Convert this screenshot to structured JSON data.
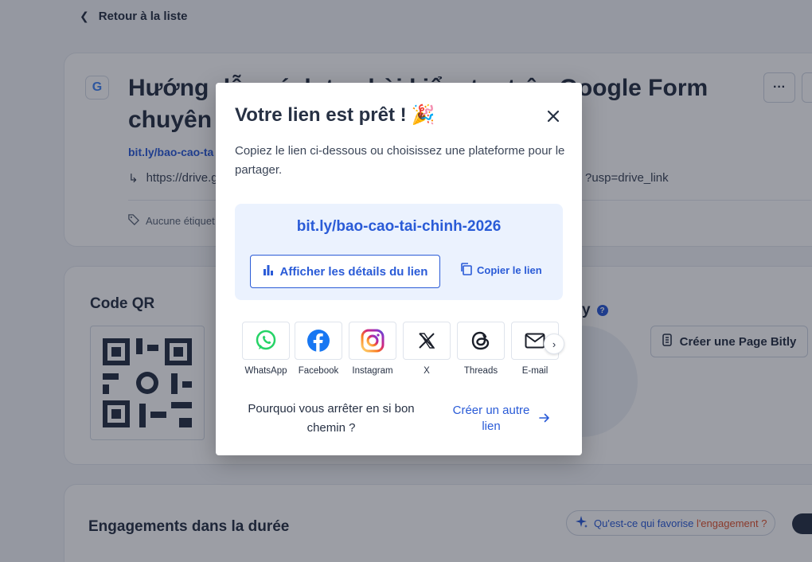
{
  "back": {
    "label": "Retour à la liste"
  },
  "link_card": {
    "title": "Hướng dẫn cách tạo bài kiểm tra trên Google Form chuyên",
    "short_link_partial": "bit.ly/bao-cao-ta",
    "long_url_start": "https://drive.g",
    "long_url_end": "?usp=drive_link",
    "tags_label": "Aucune étiquet"
  },
  "qr_card": {
    "title": "Code QR",
    "bitly_title_tail": "y",
    "page_button": "Créer une Page Bitly"
  },
  "engagement": {
    "title": "Engagements dans la durée",
    "pill_text": "Qu'est-ce qui favorise ",
    "pill_accent": "l'engagement ?"
  },
  "modal": {
    "title": "Votre lien est prêt !",
    "title_emoji": "🎉",
    "description": "Copiez le lien ci-dessous ou choisissez une plateforme pour le partager.",
    "short_link": "bit.ly/bao-cao-tai-chinh-2026",
    "details_button": "Afficher les détails du lien",
    "copy_button": "Copier le lien",
    "share": [
      {
        "label": "WhatsApp",
        "icon": "whatsapp-icon"
      },
      {
        "label": "Facebook",
        "icon": "facebook-icon"
      },
      {
        "label": "Instagram",
        "icon": "instagram-icon"
      },
      {
        "label": "X",
        "icon": "x-icon"
      },
      {
        "label": "Threads",
        "icon": "threads-icon"
      },
      {
        "label": "E-mail",
        "icon": "email-icon"
      }
    ],
    "why_text": "Pourquoi vous arrêter en si bon chemin ?",
    "create_another": "Créer un autre lien"
  },
  "colors": {
    "brand_blue": "#2a5bd7",
    "link_box_bg": "#ebf2fe",
    "accent_orange": "#e0542f"
  }
}
